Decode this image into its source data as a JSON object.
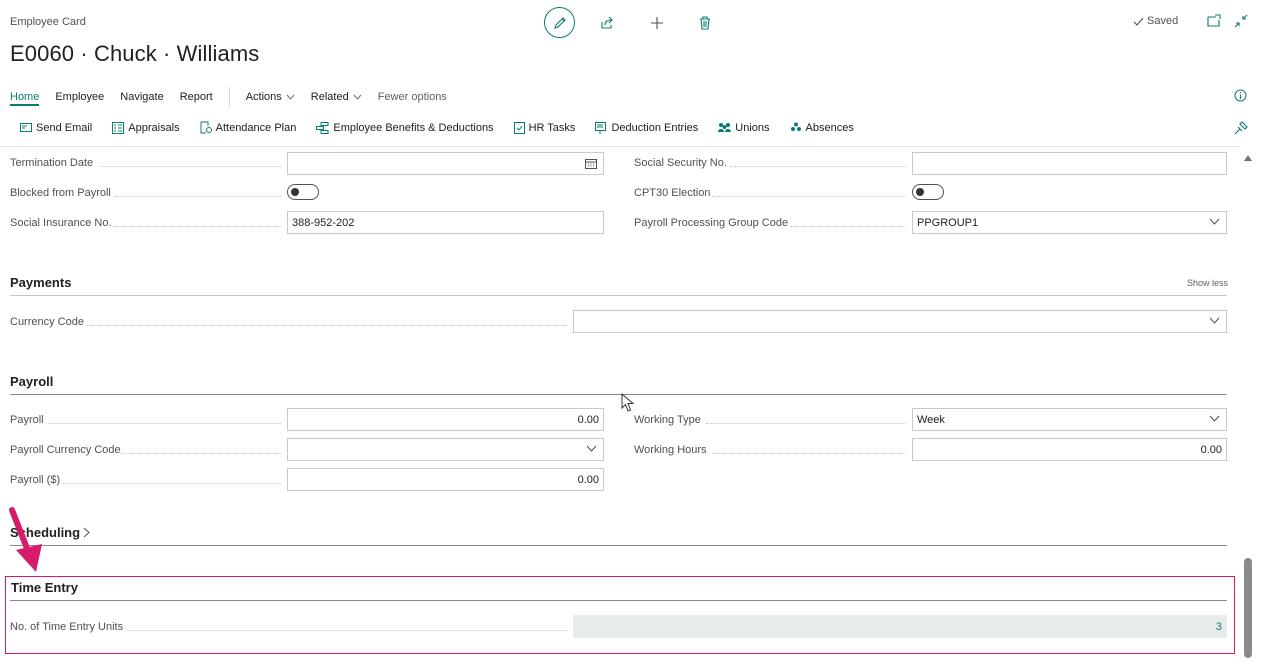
{
  "header": {
    "card_type": "Employee Card",
    "title": "E0060 · Chuck · Williams",
    "saved_label": "Saved"
  },
  "menubar": {
    "items": [
      "Home",
      "Employee",
      "Navigate",
      "Report"
    ],
    "dropdowns": [
      "Actions",
      "Related"
    ],
    "fewer_options": "Fewer options"
  },
  "actionbar": {
    "items": [
      {
        "label": "Send Email",
        "icon": "email-icon"
      },
      {
        "label": "Appraisals",
        "icon": "appraisals-icon"
      },
      {
        "label": "Attendance Plan",
        "icon": "attendance-icon"
      },
      {
        "label": "Employee Benefits & Deductions",
        "icon": "benefits-icon"
      },
      {
        "label": "HR Tasks",
        "icon": "tasks-icon"
      },
      {
        "label": "Deduction Entries",
        "icon": "deduction-icon"
      },
      {
        "label": "Unions",
        "icon": "unions-icon"
      },
      {
        "label": "Absences",
        "icon": "absences-icon"
      }
    ]
  },
  "top_fields": {
    "termination_date": {
      "label": "Termination Date",
      "value": ""
    },
    "social_security": {
      "label": "Social Security No.",
      "value": ""
    },
    "blocked_payroll": {
      "label": "Blocked from Payroll",
      "value": "off"
    },
    "cpt30": {
      "label": "CPT30 Election",
      "value": "off"
    },
    "social_insurance": {
      "label": "Social Insurance No.",
      "value": "388-952-202"
    },
    "payroll_group": {
      "label": "Payroll Processing Group Code",
      "value": "PPGROUP1"
    }
  },
  "payments": {
    "title": "Payments",
    "show_less": "Show less",
    "currency_code": {
      "label": "Currency Code",
      "value": ""
    }
  },
  "payroll": {
    "title": "Payroll",
    "payroll": {
      "label": "Payroll",
      "value": "0.00"
    },
    "payroll_currency": {
      "label": "Payroll Currency Code",
      "value": ""
    },
    "payroll_usd": {
      "label": "Payroll ($)",
      "value": "0.00"
    },
    "working_type": {
      "label": "Working Type",
      "value": "Week"
    },
    "working_hours": {
      "label": "Working Hours",
      "value": "0.00"
    }
  },
  "scheduling": {
    "title": "Scheduling"
  },
  "time_entry": {
    "title": "Time Entry",
    "units": {
      "label": "No. of Time Entry Units",
      "value": "3"
    }
  },
  "colors": {
    "accent": "#0a7c6f",
    "highlight": "#d61b6a"
  }
}
